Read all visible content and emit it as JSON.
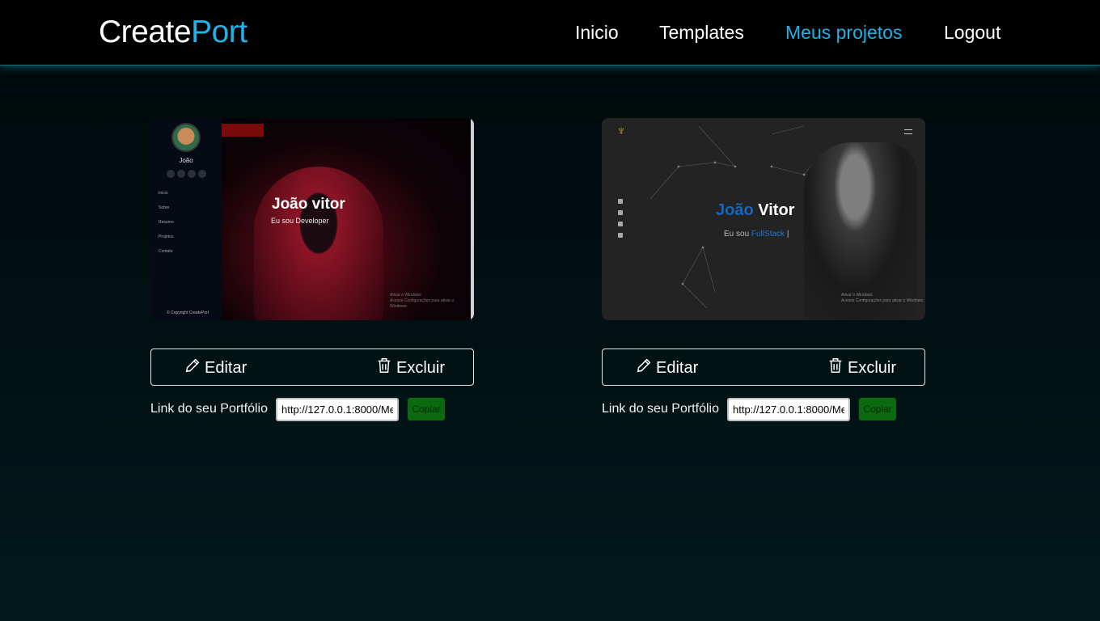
{
  "brand": {
    "name_part1": "Create",
    "name_part2": "Port",
    "accent_color": "#1fb3ee"
  },
  "nav": {
    "items": [
      {
        "label": "Inicio"
      },
      {
        "label": "Templates"
      },
      {
        "label": "Meus projetos",
        "active": true
      },
      {
        "label": "Logout"
      }
    ]
  },
  "projects": [
    {
      "actions": {
        "edit_label": "Editar",
        "delete_label": "Excluir"
      },
      "link_label": "Link do seu Portfólio",
      "link_value": "http://127.0.0.1:8000/Me",
      "copy_label": "Copiar",
      "preview": {
        "name": "João",
        "hero_title": "João vitor",
        "hero_subtitle": "Eu sou Developer",
        "menu": [
          "Inicio",
          "Sobre",
          "Resumo",
          "Projetos",
          "Contato"
        ],
        "footer": "© Copyright CreatePort",
        "activation": "Ativar o Windows",
        "activation_sub": "Acesse Configurações para ativar o Windows."
      }
    },
    {
      "actions": {
        "edit_label": "Editar",
        "delete_label": "Excluir"
      },
      "link_label": "Link do seu Portfólio",
      "link_value": "http://127.0.0.1:8000/Me",
      "copy_label": "Copiar",
      "preview": {
        "title_first": "João",
        "title_last": " Vitor",
        "subtitle_prefix": "Eu sou ",
        "subtitle_accent": "FullStack",
        "subtitle_suffix": " |",
        "activation": "Ativar o Windows",
        "activation_sub": "Acesse Configurações para ativar o Windows."
      }
    }
  ],
  "colors": {
    "copy_button": "#0b6a10",
    "active_nav": "#23b0e6"
  }
}
